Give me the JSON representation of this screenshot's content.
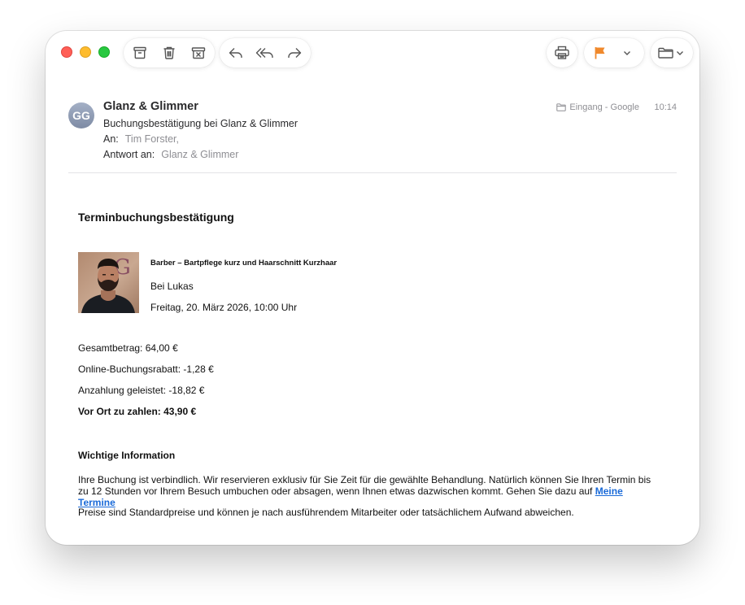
{
  "toolbar": {
    "archive_icon": "archive-box-icon",
    "trash_icon": "trash-icon",
    "junk_icon": "junk-icon",
    "reply_icon": "reply-icon",
    "reply_all_icon": "reply-all-icon",
    "forward_icon": "forward-icon",
    "print_icon": "printer-icon",
    "flag_icon": "flag-icon",
    "flag_color": "#f0892c",
    "menu_icon": "chevron-down-icon",
    "move_icon": "folder-icon"
  },
  "header": {
    "avatar_initials": "GG",
    "sender": "Glanz & Glimmer",
    "subject": "Buchungsbestätigung bei Glanz & Glimmer",
    "to_label": "An:",
    "to_value": "Tim Forster,",
    "reply_label": "Antwort an:",
    "reply_value": "Glanz & Glimmer",
    "mailbox": "Eingang - Google",
    "time": "10:14"
  },
  "email": {
    "heading": "Terminbuchungsbestätigung",
    "service": {
      "title": "Barber – Bartpflege kurz und Haarschnitt Kurzhaar",
      "staff": "Bei Lukas",
      "datetime": "Freitag, 20. März 2026, 10:00 Uhr"
    },
    "totals": {
      "total": "Gesamtbetrag: 64,00 €",
      "discount": "Online-Buchungsrabatt: -1,28 €",
      "deposit": "Anzahlung geleistet: -18,82 €",
      "due": "Vor Ort zu zahlen: 43,90 €"
    },
    "info_heading": "Wichtige Information",
    "info_text": "Ihre Buchung ist verbindlich. Wir reservieren exklusiv für Sie Zeit für die gewählte Behandlung. Natürlich können Sie Ihren Termin bis zu 12 Stunden vor Ihrem Besuch umbuchen oder absagen, wenn Ihnen etwas dazwischen kommt. Gehen Sie dazu auf",
    "info_link": "Meine Termine",
    "price_note": "Preise sind Standardpreise und können je nach ausführendem Mitarbeiter oder tatsächlichem Aufwand abweichen."
  }
}
